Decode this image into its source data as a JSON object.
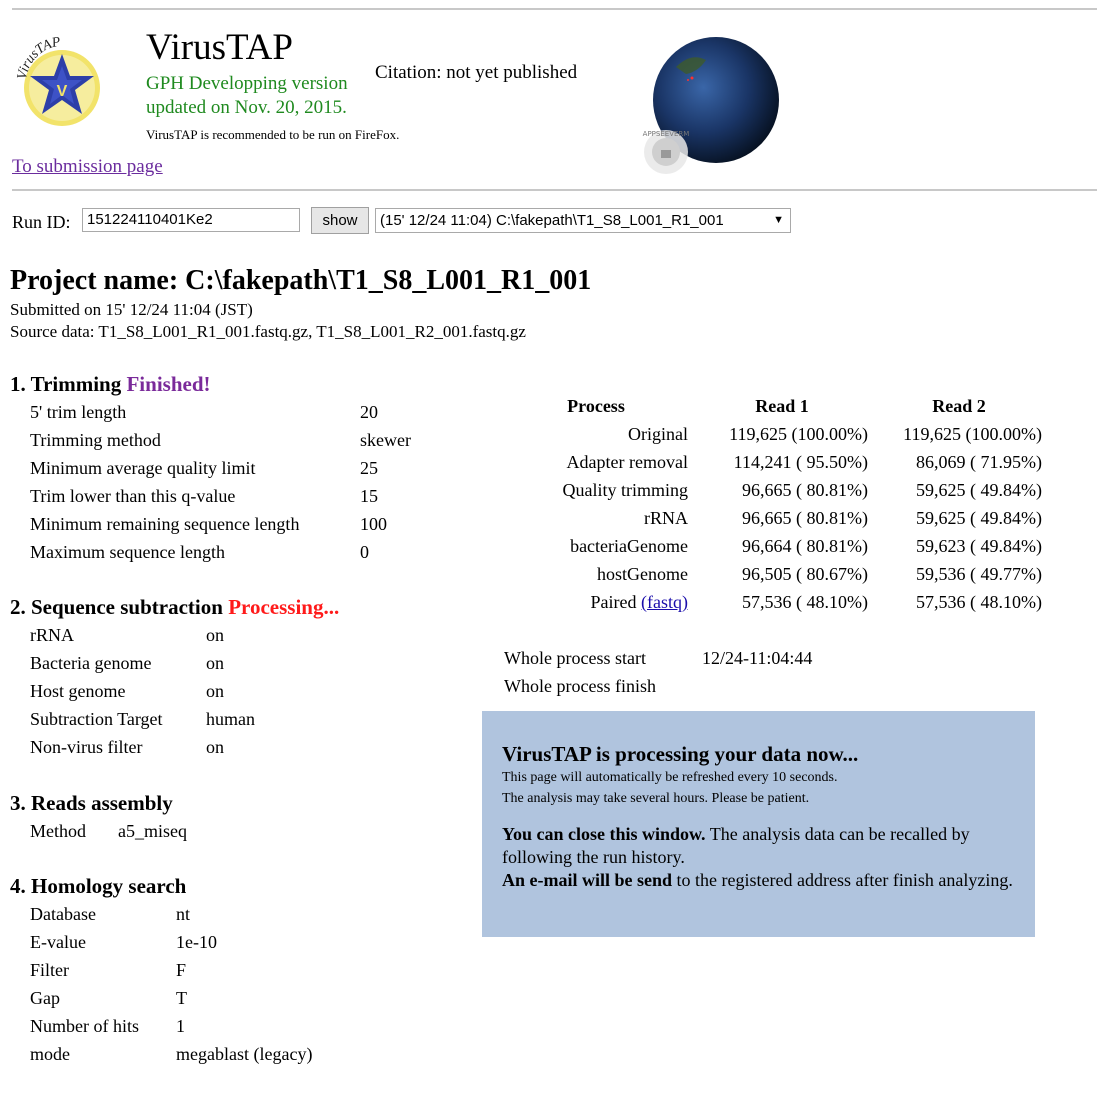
{
  "header": {
    "title": "VirusTAP",
    "version": "GPH Developping version",
    "updated": "updated on Nov. 20, 2015.",
    "citation": "Citation: not yet published",
    "firefox_note": "VirusTAP is recommended to be run on FireFox.",
    "submission_link": "To submission page",
    "logo_text": "VirusTAP",
    "globe_badge": "APPSEEVERM"
  },
  "run": {
    "label": "Run ID:",
    "id_value": "151224110401Ke2",
    "show_label": "show",
    "selected": "(15' 12/24 11:04) C:\\fakepath\\T1_S8_L001_R1_001"
  },
  "project": {
    "name": "Project name: C:\\fakepath\\T1_S8_L001_R1_001",
    "submitted": "Submitted on 15' 12/24 11:04 (JST)",
    "source": "Source data: T1_S8_L001_R1_001.fastq.gz, T1_S8_L001_R2_001.fastq.gz"
  },
  "trimming": {
    "title": "1. Trimming",
    "status": "Finished!",
    "rows": [
      {
        "label": "5' trim length",
        "value": "20"
      },
      {
        "label": "Trimming method",
        "value": "skewer"
      },
      {
        "label": "Minimum average quality limit",
        "value": "25"
      },
      {
        "label": "Trim lower than this q-value",
        "value": "15"
      },
      {
        "label": "Minimum remaining sequence length",
        "value": "100"
      },
      {
        "label": "Maximum sequence length",
        "value": "0"
      }
    ]
  },
  "subtraction": {
    "title": "2. Sequence subtraction",
    "status": "Processing...",
    "rows": [
      {
        "label": "rRNA",
        "value": "on"
      },
      {
        "label": "Bacteria genome",
        "value": "on"
      },
      {
        "label": "Host genome",
        "value": "on"
      },
      {
        "label": "Subtraction Target",
        "value": "human"
      },
      {
        "label": "Non-virus filter",
        "value": "on"
      }
    ]
  },
  "assembly": {
    "title": "3. Reads assembly",
    "rows": [
      {
        "label": "Method",
        "value": "a5_miseq"
      }
    ]
  },
  "homology": {
    "title": "4. Homology search",
    "rows": [
      {
        "label": "Database",
        "value": "nt"
      },
      {
        "label": "E-value",
        "value": "1e-10"
      },
      {
        "label": "Filter",
        "value": "F"
      },
      {
        "label": "Gap",
        "value": "T"
      },
      {
        "label": "Number of hits",
        "value": "1"
      },
      {
        "label": "mode",
        "value": "megablast (legacy)"
      }
    ]
  },
  "process_table": {
    "headers": [
      "Process",
      "Read 1",
      "Read 2"
    ],
    "rows": [
      {
        "name": "Original",
        "r1": "119,625 (100.00%)",
        "r2": "119,625 (100.00%)"
      },
      {
        "name": "Adapter removal",
        "r1": "114,241 ( 95.50%)",
        "r2": "86,069 ( 71.95%)"
      },
      {
        "name": "Quality trimming",
        "r1": "96,665 ( 80.81%)",
        "r2": "59,625 ( 49.84%)"
      },
      {
        "name": "rRNA",
        "r1": "96,665 ( 80.81%)",
        "r2": "59,625 ( 49.84%)"
      },
      {
        "name": "bacteriaGenome",
        "r1": "96,664 ( 80.81%)",
        "r2": "59,623 ( 49.84%)"
      },
      {
        "name": "hostGenome",
        "r1": "96,505 ( 80.67%)",
        "r2": "59,536 ( 49.77%)"
      },
      {
        "name": "Paired",
        "link": "(fastq)",
        "r1": "57,536 ( 48.10%)",
        "r2": "57,536 ( 48.10%)"
      }
    ]
  },
  "timing": {
    "start_label": "Whole process start",
    "start_value": "12/24-11:04:44",
    "finish_label": "Whole process finish",
    "finish_value": ""
  },
  "status_box": {
    "title": "VirusTAP is processing your data now...",
    "line1": "This page will automatically be refreshed every 10 seconds.",
    "line2": "The analysis may take several hours. Please be patient.",
    "close_bold": "You can close this window.",
    "close_rest": " The analysis data can be recalled by following the run history.",
    "email_bold": "An e-mail will be send",
    "email_rest": " to the registered address after finish analyzing.",
    "bg_color": "#b0c4de"
  },
  "colors": {
    "green": "#1f8a1f",
    "finished": "#7a2a9a",
    "processing": "#ff1a1a",
    "link": "#6b2c9e"
  }
}
